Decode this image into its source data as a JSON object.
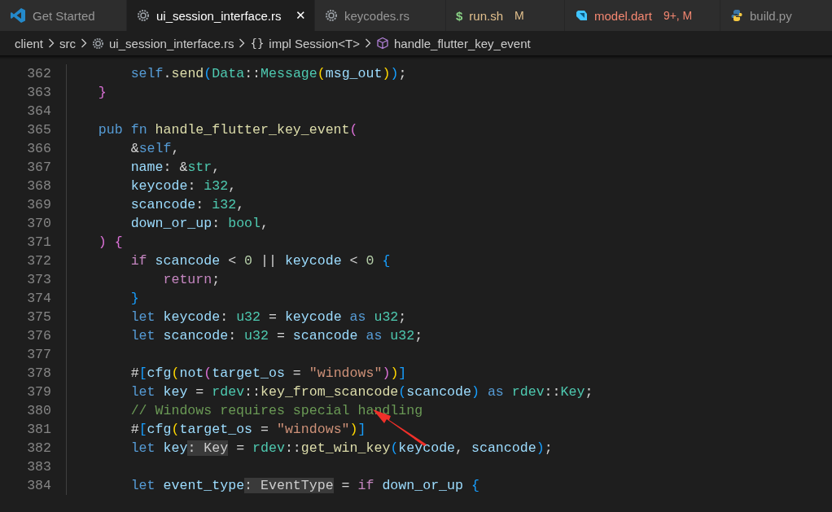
{
  "tabs": [
    {
      "label": "Get Started",
      "kind": "welcome",
      "selected": false
    },
    {
      "label": "ui_session_interface.rs",
      "kind": "rust",
      "selected": true,
      "close": "✕"
    },
    {
      "label": "keycodes.rs",
      "kind": "rust",
      "selected": false
    },
    {
      "label": "run.sh",
      "kind": "shell",
      "glyph": "$",
      "selected": false,
      "badge": "M",
      "color": "#e2c08d"
    },
    {
      "label": "model.dart",
      "kind": "dart",
      "selected": false,
      "badge": "9+, M",
      "color": "#f48771"
    },
    {
      "label": "build.py",
      "kind": "python",
      "selected": false
    }
  ],
  "breadcrumbs": [
    {
      "label": "client",
      "kind": "folder"
    },
    {
      "label": "src",
      "kind": "folder"
    },
    {
      "label": "ui_session_interface.rs",
      "kind": "rust"
    },
    {
      "label": "impl Session<T>",
      "kind": "scope",
      "glyph": "{}"
    },
    {
      "label": "handle_flutter_key_event",
      "kind": "method"
    }
  ],
  "lines": [
    {
      "number": "362",
      "tokens": [
        {
          "t": "        self",
          "kind": "kw"
        },
        {
          "t": "."
        },
        {
          "t": "send",
          "kind": "fn"
        },
        {
          "t": "(",
          "kind": "b3"
        },
        {
          "t": "Data",
          "kind": "type"
        },
        {
          "t": "::"
        },
        {
          "t": "Message",
          "kind": "type"
        },
        {
          "t": "(",
          "kind": "b1"
        },
        {
          "t": "msg_out",
          "kind": "var"
        },
        {
          "t": ")",
          "kind": "b1"
        },
        {
          "t": ")",
          "kind": "b3"
        },
        {
          "t": ";"
        }
      ]
    },
    {
      "number": "363",
      "tokens": [
        {
          "t": "    }",
          "kind": "b2"
        }
      ]
    },
    {
      "number": "364"
    },
    {
      "number": "365",
      "tokens": [
        {
          "t": "    pub",
          "kind": "kw"
        },
        {
          "t": " fn",
          "kind": "kw"
        },
        {
          "t": " handle_flutter_key_event",
          "kind": "fn"
        },
        {
          "t": "(",
          "kind": "b2"
        }
      ]
    },
    {
      "number": "366",
      "tokens": [
        {
          "t": "        &"
        },
        {
          "t": "self",
          "kind": "kw"
        },
        {
          "t": ","
        }
      ]
    },
    {
      "number": "367",
      "tokens": [
        {
          "t": "        name",
          "kind": "var"
        },
        {
          "t": ": &"
        },
        {
          "t": "str",
          "kind": "type"
        },
        {
          "t": ","
        }
      ]
    },
    {
      "number": "368",
      "tokens": [
        {
          "t": "        keycode",
          "kind": "var"
        },
        {
          "t": ": "
        },
        {
          "t": "i32",
          "kind": "type"
        },
        {
          "t": ","
        }
      ]
    },
    {
      "number": "369",
      "tokens": [
        {
          "t": "        scancode",
          "kind": "var"
        },
        {
          "t": ": "
        },
        {
          "t": "i32",
          "kind": "type"
        },
        {
          "t": ","
        }
      ]
    },
    {
      "number": "370",
      "tokens": [
        {
          "t": "        down_or_up",
          "kind": "var"
        },
        {
          "t": ": "
        },
        {
          "t": "bool",
          "kind": "type"
        },
        {
          "t": ","
        }
      ]
    },
    {
      "number": "371",
      "tokens": [
        {
          "t": "    )",
          "kind": "b2"
        },
        {
          "t": " {",
          "kind": "b2"
        }
      ]
    },
    {
      "number": "372",
      "tokens": [
        {
          "t": "        if",
          "kind": "ctrl"
        },
        {
          "t": " scancode",
          "kind": "var"
        },
        {
          "t": " < "
        },
        {
          "t": "0",
          "kind": "num"
        },
        {
          "t": " || "
        },
        {
          "t": "keycode",
          "kind": "var"
        },
        {
          "t": " < "
        },
        {
          "t": "0",
          "kind": "num"
        },
        {
          "t": " {",
          "kind": "b3"
        }
      ]
    },
    {
      "number": "373",
      "tokens": [
        {
          "t": "            return",
          "kind": "ctrl"
        },
        {
          "t": ";"
        }
      ]
    },
    {
      "number": "374",
      "tokens": [
        {
          "t": "        }",
          "kind": "b3"
        }
      ]
    },
    {
      "number": "375",
      "tokens": [
        {
          "t": "        let",
          "kind": "kw"
        },
        {
          "t": " keycode",
          "kind": "var"
        },
        {
          "t": ": "
        },
        {
          "t": "u32",
          "kind": "type"
        },
        {
          "t": " = "
        },
        {
          "t": "keycode",
          "kind": "var"
        },
        {
          "t": " as",
          "kind": "kw"
        },
        {
          "t": " u32",
          "kind": "type"
        },
        {
          "t": ";"
        }
      ]
    },
    {
      "number": "376",
      "tokens": [
        {
          "t": "        let",
          "kind": "kw"
        },
        {
          "t": " scancode",
          "kind": "var"
        },
        {
          "t": ": "
        },
        {
          "t": "u32",
          "kind": "type"
        },
        {
          "t": " = "
        },
        {
          "t": "scancode",
          "kind": "var"
        },
        {
          "t": " as",
          "kind": "kw"
        },
        {
          "t": " u32",
          "kind": "type"
        },
        {
          "t": ";"
        }
      ]
    },
    {
      "number": "377"
    },
    {
      "number": "378",
      "tokens": [
        {
          "t": "        #"
        },
        {
          "t": "[",
          "kind": "b3"
        },
        {
          "t": "cfg",
          "kind": "var"
        },
        {
          "t": "(",
          "kind": "b1"
        },
        {
          "t": "not",
          "kind": "var"
        },
        {
          "t": "(",
          "kind": "b2"
        },
        {
          "t": "target_os",
          "kind": "var"
        },
        {
          "t": " = "
        },
        {
          "t": "\"windows\"",
          "kind": "str"
        },
        {
          "t": ")",
          "kind": "b2"
        },
        {
          "t": ")",
          "kind": "b1"
        },
        {
          "t": "]",
          "kind": "b3"
        }
      ]
    },
    {
      "number": "379",
      "tokens": [
        {
          "t": "        let",
          "kind": "kw"
        },
        {
          "t": " key",
          "kind": "var"
        },
        {
          "t": " = "
        },
        {
          "t": "rdev",
          "kind": "type"
        },
        {
          "t": "::"
        },
        {
          "t": "key_from_scancode",
          "kind": "fn"
        },
        {
          "t": "(",
          "kind": "b3"
        },
        {
          "t": "scancode",
          "kind": "var"
        },
        {
          "t": ")",
          "kind": "b3"
        },
        {
          "t": " as",
          "kind": "kw"
        },
        {
          "t": " rdev",
          "kind": "type"
        },
        {
          "t": "::"
        },
        {
          "t": "Key",
          "kind": "type"
        },
        {
          "t": ";"
        }
      ]
    },
    {
      "number": "380",
      "tokens": [
        {
          "t": "        // Windows requires special handling",
          "kind": "comment"
        }
      ]
    },
    {
      "number": "381",
      "tokens": [
        {
          "t": "        #"
        },
        {
          "t": "[",
          "kind": "b3"
        },
        {
          "t": "cfg",
          "kind": "var"
        },
        {
          "t": "(",
          "kind": "b1"
        },
        {
          "t": "target_os",
          "kind": "var"
        },
        {
          "t": " = "
        },
        {
          "t": "\"windows\"",
          "kind": "str"
        },
        {
          "t": ")",
          "kind": "b1"
        },
        {
          "t": "]",
          "kind": "b3"
        }
      ]
    },
    {
      "number": "382",
      "tokens": [
        {
          "t": "        let",
          "kind": "kw"
        },
        {
          "t": " key",
          "kind": "var"
        },
        {
          "t": ": Key",
          "kind": "hint"
        },
        {
          "t": " = "
        },
        {
          "t": "rdev",
          "kind": "type"
        },
        {
          "t": "::"
        },
        {
          "t": "get_win_key",
          "kind": "fn"
        },
        {
          "t": "(",
          "kind": "b3"
        },
        {
          "t": "keycode",
          "kind": "var"
        },
        {
          "t": ", "
        },
        {
          "t": "scancode",
          "kind": "var"
        },
        {
          "t": ")",
          "kind": "b3"
        },
        {
          "t": ";"
        }
      ]
    },
    {
      "number": "383"
    },
    {
      "number": "384",
      "tokens": [
        {
          "t": "        let",
          "kind": "kw"
        },
        {
          "t": " event_type",
          "kind": "var"
        },
        {
          "t": ": EventType",
          "kind": "hint"
        },
        {
          "t": " = "
        },
        {
          "t": "if",
          "kind": "ctrl"
        },
        {
          "t": " down_or_up",
          "kind": "var"
        },
        {
          "t": " {",
          "kind": "b3"
        }
      ]
    }
  ]
}
